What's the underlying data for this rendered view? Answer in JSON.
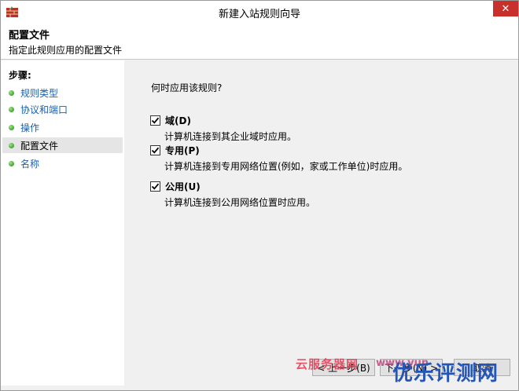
{
  "window": {
    "title": "新建入站规则向导",
    "close_symbol": "✕"
  },
  "header": {
    "title": "配置文件",
    "subtitle": "指定此规则应用的配置文件"
  },
  "sidebar": {
    "steps_title": "步骤:",
    "items": [
      {
        "label": "规则类型",
        "active": false
      },
      {
        "label": "协议和端口",
        "active": false
      },
      {
        "label": "操作",
        "active": false
      },
      {
        "label": "配置文件",
        "active": true
      },
      {
        "label": "名称",
        "active": false
      }
    ]
  },
  "main": {
    "question": "何时应用该规则?",
    "options": [
      {
        "label": "域(D)",
        "description": "计算机连接到其企业域时应用。",
        "checked": true
      },
      {
        "label": "专用(P)",
        "description": "计算机连接到专用网络位置(例如，家或工作单位)时应用。",
        "checked": true
      },
      {
        "label": "公用(U)",
        "description": "计算机连接到公用网络位置时应用。",
        "checked": true
      }
    ]
  },
  "buttons": {
    "back": "< 上一步(B)",
    "next": "下一步(N) >",
    "cancel": "取消"
  },
  "watermarks": {
    "left": "云服务器网",
    "middle": "www.yun",
    "right": "优乐评测网"
  },
  "colors": {
    "close_button": "#c7302b",
    "link": "#1a5fae",
    "active_step": "#e5e5e5"
  }
}
